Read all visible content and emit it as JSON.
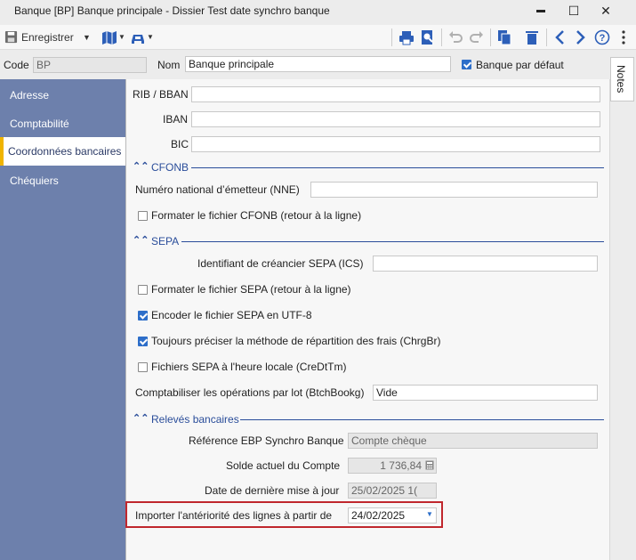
{
  "window": {
    "title": "Banque [BP] Banque principale - Dissier Test date synchro banque",
    "minimize": "▬",
    "maximize": "☐",
    "close": "✕"
  },
  "toolbar": {
    "save_label": "Enregistrer"
  },
  "header": {
    "code_label": "Code",
    "code_value": "BP",
    "nom_label": "Nom",
    "nom_value": "Banque principale",
    "default_label": "Banque par défaut",
    "default_checked": true
  },
  "notes_tab": "Notes",
  "sidebar": {
    "items": [
      {
        "label": "Adresse"
      },
      {
        "label": "Comptabilité"
      },
      {
        "label": "Coordonnées bancaires",
        "active": true
      },
      {
        "label": "Chéquiers"
      }
    ]
  },
  "bank": {
    "rib_label": "RIB / BBAN",
    "rib_value": "",
    "iban_label": "IBAN",
    "iban_value": "",
    "bic_label": "BIC",
    "bic_value": ""
  },
  "cfonb": {
    "title": "CFONB",
    "nne_label": "Numéro national d’émetteur (NNE)",
    "nne_value": "",
    "format_label": "Formater le fichier CFONB (retour à la ligne)",
    "format_checked": false
  },
  "sepa": {
    "title": "SEPA",
    "ics_label": "Identifiant de créancier SEPA (ICS)",
    "ics_value": "",
    "format_label": "Formater le fichier SEPA (retour à la ligne)",
    "format_checked": false,
    "utf8_label": "Encoder le fichier SEPA en UTF-8",
    "utf8_checked": true,
    "chrgbr_label": "Toujours préciser la méthode de répartition des frais (ChrgBr)",
    "chrgbr_checked": true,
    "local_label": "Fichiers SEPA à l'heure locale (CreDtTm)",
    "local_checked": false,
    "batch_label": "Comptabiliser les opérations par lot (BtchBookg)",
    "batch_value": "Vide"
  },
  "releves": {
    "title": "Relevés bancaires",
    "ref_label": "Référence EBP Synchro Banque",
    "ref_value": "Compte chèque",
    "solde_label": "Solde actuel du Compte",
    "solde_value": "1 736,84",
    "date_label": "Date de dernière mise à jour",
    "date_value": "25/02/2025 1(",
    "import_label": "Importer l'antériorité des lignes à partir de",
    "import_value": "24/02/2025"
  },
  "colors": {
    "sidebar_bg": "#6d80ac",
    "accent_blue": "#2a4d9a",
    "active_marker": "#f0b400",
    "highlight_red": "#c0272d"
  }
}
